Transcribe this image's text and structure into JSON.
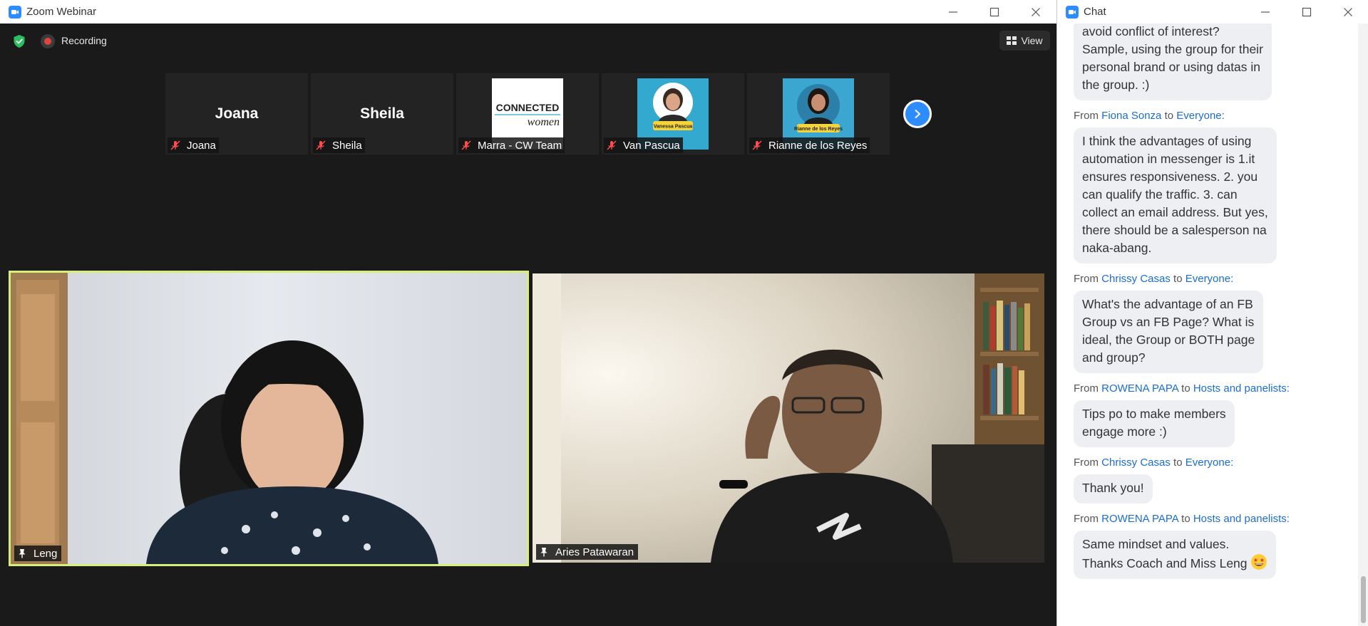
{
  "zoom_window": {
    "title": "Zoom Webinar",
    "recording_label": "Recording",
    "view_label": "View",
    "thumbnails": [
      {
        "display_name": "Joana",
        "label": "Joana"
      },
      {
        "display_name": "Sheila",
        "label": "Sheila"
      },
      {
        "display_name": "",
        "label": "Marra - CW Team",
        "image": "connected-women-logo",
        "image_text_1": "CONNECTED",
        "image_text_2": "women"
      },
      {
        "display_name": "",
        "label": "Van Pascua",
        "image": "vanessa-pascua-avatar",
        "image_text": "Vanessa Pascua"
      },
      {
        "display_name": "",
        "label": "Rianne de los Reyes",
        "image": "rianne-avatar",
        "image_text": "Rianne de los Reyes"
      }
    ],
    "videos": [
      {
        "label": "Leng"
      },
      {
        "label": "Aries Patawaran"
      }
    ],
    "active_speaker_color": "#d5f07a",
    "accent_color": "#2d8cff"
  },
  "chat_window": {
    "title": "Chat",
    "from_word": "From",
    "to_word": "to",
    "messages": [
      {
        "from": "",
        "to": "",
        "text": "avoid conflict of interest?\nSample, using the group for their\npersonal brand or using datas in\nthe group.  :)"
      },
      {
        "from": "Fiona Sonza",
        "to": "Everyone:",
        "text": "I think the advantages of using\nautomation in messenger is 1.it\nensures responsiveness. 2. you\ncan qualify the traffic. 3. can\ncollect an email address.  But yes,\nthere should be a salesperson na\nnaka-abang."
      },
      {
        "from": "Chrissy Casas",
        "to": "Everyone:",
        "text": "What's the advantage of an FB\nGroup vs an FB Page? What is\nideal, the Group or BOTH page\nand group?"
      },
      {
        "from": "ROWENA PAPA",
        "to": "Hosts and panelists:",
        "text": "Tips po to make members\nengage more :)"
      },
      {
        "from": "Chrissy Casas",
        "to": "Everyone:",
        "text": "Thank you!"
      },
      {
        "from": "ROWENA PAPA",
        "to": "Hosts and panelists:",
        "text": "Same mindset and values.\nThanks Coach and Miss Leng",
        "emoji": "star-struck-emoji"
      }
    ]
  }
}
